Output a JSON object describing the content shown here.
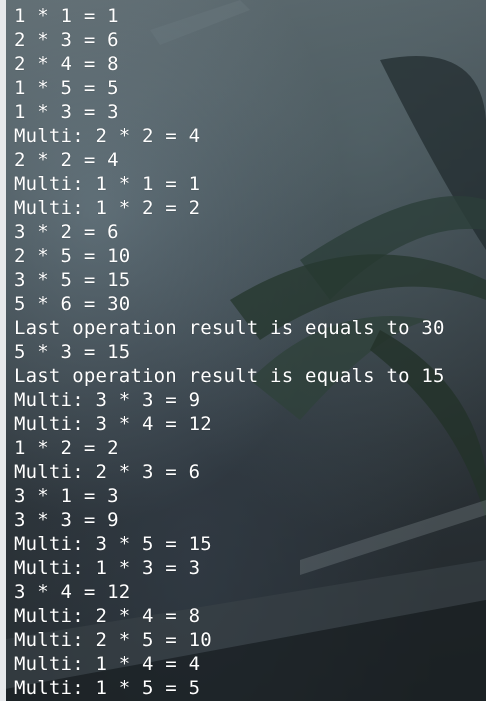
{
  "terminal": {
    "lines": [
      "1 * 1 = 1",
      "2 * 3 = 6",
      "2 * 4 = 8",
      "1 * 5 = 5",
      "1 * 3 = 3",
      "Multi: 2 * 2 = 4",
      "2 * 2 = 4",
      "Multi: 1 * 1 = 1",
      "Multi: 1 * 2 = 2",
      "3 * 2 = 6",
      "2 * 5 = 10",
      "3 * 5 = 15",
      "5 * 6 = 30",
      "Last operation result is equals to 30",
      "5 * 3 = 15",
      "Last operation result is equals to 15",
      "Multi: 3 * 3 = 9",
      "Multi: 3 * 4 = 12",
      "1 * 2 = 2",
      "Multi: 2 * 3 = 6",
      "3 * 1 = 3",
      "3 * 3 = 9",
      "Multi: 3 * 5 = 15",
      "Multi: 1 * 3 = 3",
      "3 * 4 = 12",
      "Multi: 2 * 4 = 8",
      "Multi: 2 * 5 = 10",
      "Multi: 1 * 4 = 4",
      "Multi: 1 * 5 = 5"
    ]
  },
  "colors": {
    "text": "#ffffff",
    "background": "#2b3237"
  }
}
